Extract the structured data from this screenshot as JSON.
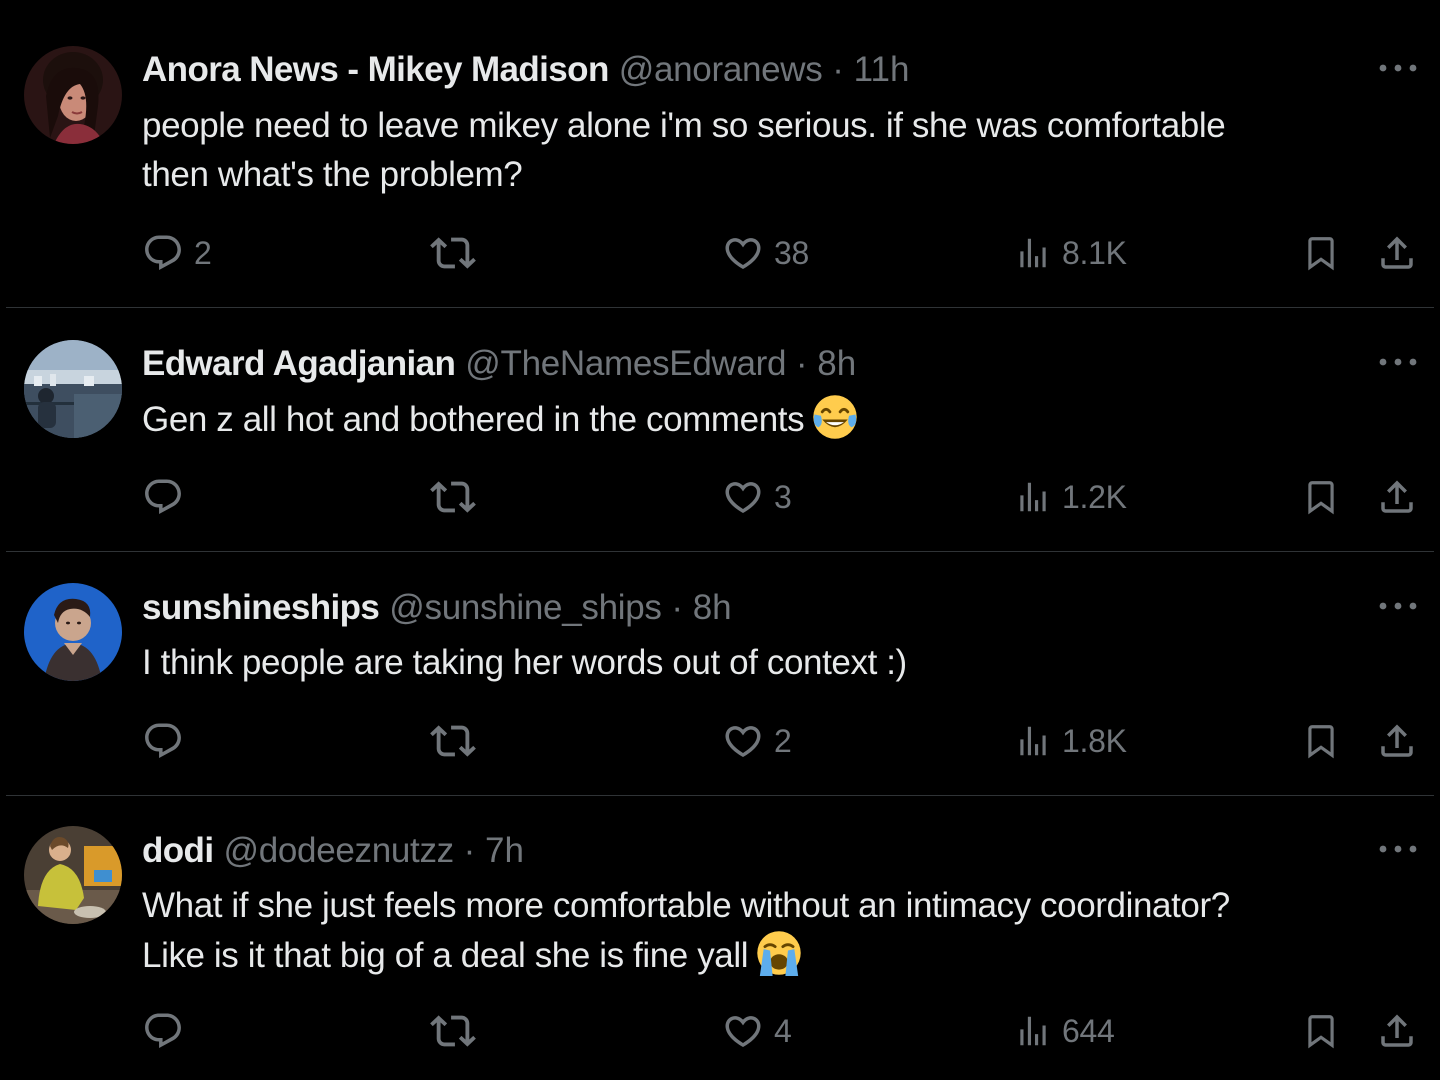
{
  "colors": {
    "background": "#000000",
    "text_primary": "#e7e9ea",
    "text_secondary": "#71767b",
    "divider": "#2f3336"
  },
  "tweets": [
    {
      "display_name": "Anora News - Mikey Madison",
      "handle": "@anoranews",
      "separator": "·",
      "time": "11h",
      "text_lines": [
        "people need to leave mikey alone i'm so serious. if she was comfortable",
        "then what's the problem?"
      ],
      "emoji": "",
      "replies": "2",
      "retweets": "",
      "likes": "38",
      "views": "8.1K",
      "avatar": "profile-photo-woman"
    },
    {
      "display_name": "Edward Agadjanian",
      "handle": "@TheNamesEdward",
      "separator": "·",
      "time": "8h",
      "text_lines": [
        "Gen z all hot and bothered in the comments"
      ],
      "emoji": "face-with-tears-of-joy",
      "replies": "",
      "retweets": "",
      "likes": "3",
      "views": "1.2K",
      "avatar": "profile-photo-city"
    },
    {
      "display_name": "sunshineships",
      "handle": "@sunshine_ships",
      "separator": "·",
      "time": "8h",
      "text_lines": [
        "I think people are taking her words out of context :)"
      ],
      "emoji": "",
      "replies": "",
      "retweets": "",
      "likes": "2",
      "views": "1.8K",
      "avatar": "profile-photo-blue"
    },
    {
      "display_name": "dodi",
      "handle": "@dodeeznutzz",
      "separator": "·",
      "time": "7h",
      "text_lines": [
        "What if she just feels more comfortable without an intimacy coordinator?",
        "Like is it that big of a deal she is fine yall"
      ],
      "emoji": "loudly-crying-face",
      "replies": "",
      "retweets": "",
      "likes": "4",
      "views": "644",
      "avatar": "profile-photo-yellow-jacket"
    }
  ]
}
